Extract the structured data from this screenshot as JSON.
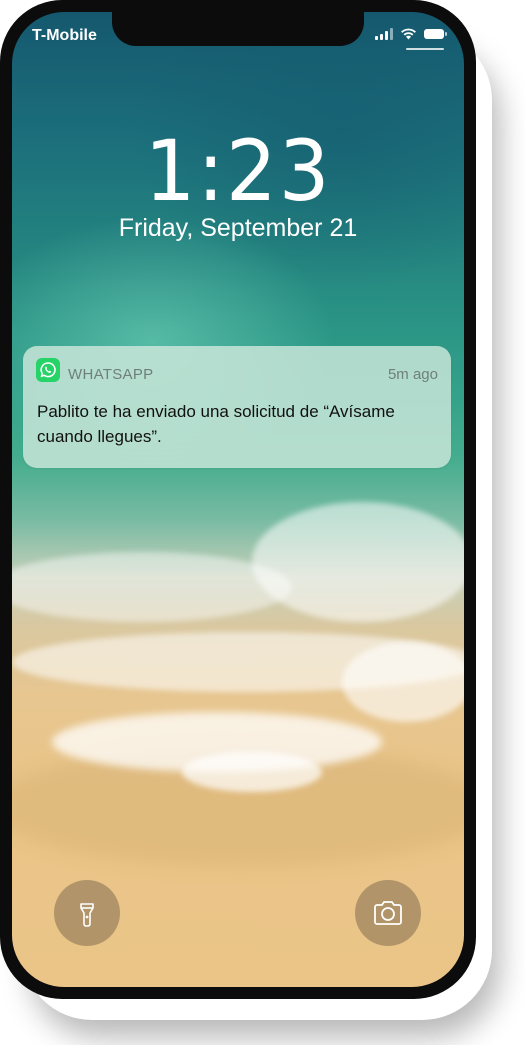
{
  "status_bar": {
    "carrier": "T-Mobile",
    "signal_icon": "cellular-signal-icon",
    "wifi_icon": "wifi-icon",
    "battery_icon": "battery-icon"
  },
  "lock_screen": {
    "time": "1:23",
    "date": "Friday, September 21"
  },
  "notification": {
    "app_icon": "whatsapp-icon",
    "app_name": "WHATSAPP",
    "time_ago": "5m ago",
    "message": "Pablito te ha enviado una solicitud de “Avísame cuando llegues”."
  },
  "quick_actions": {
    "left_icon": "flashlight-icon",
    "right_icon": "camera-icon"
  },
  "colors": {
    "whatsapp_green": "#25D366",
    "notification_bg": "#cde8dc",
    "sand": "#ebc588",
    "ocean": "#1b6d7b"
  }
}
